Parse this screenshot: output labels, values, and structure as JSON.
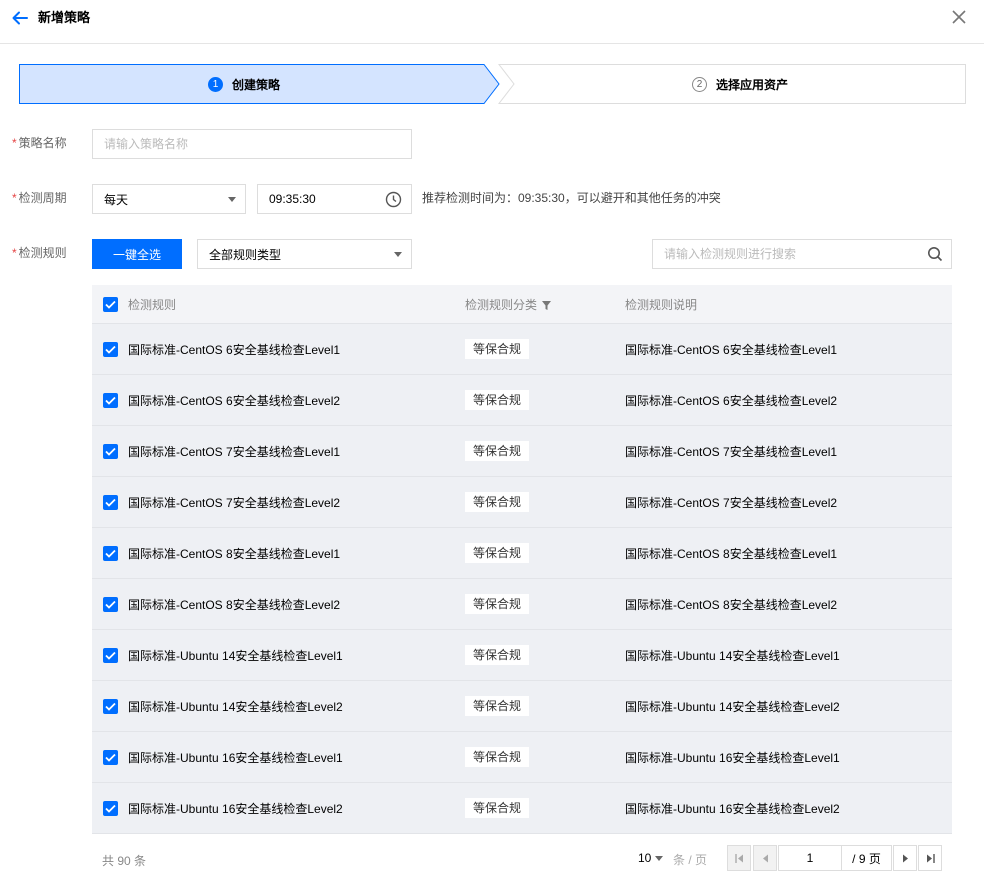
{
  "header": {
    "title": "新增策略"
  },
  "steps": [
    {
      "num": "1",
      "label": "创建策略"
    },
    {
      "num": "2",
      "label": "选择应用资产"
    }
  ],
  "form": {
    "name": {
      "label": "策略名称",
      "placeholder": "请输入策略名称",
      "value": ""
    },
    "period": {
      "label": "检测周期",
      "frequency": "每天",
      "time": "09:35:30",
      "hint": "推荐检测时间为：09:35:30，可以避开和其他任务的冲突"
    },
    "rules": {
      "label": "检测规则",
      "select_all": "一键全选",
      "type_filter": "全部规则类型",
      "search_placeholder": "请输入检测规则进行搜索"
    }
  },
  "table": {
    "headers": {
      "rule": "检测规则",
      "category": "检测规则分类",
      "description": "检测规则说明"
    },
    "rows": [
      {
        "rule": "国际标准-CentOS 6安全基线检查Level1",
        "category": "等保合规",
        "description": "国际标准-CentOS 6安全基线检查Level1"
      },
      {
        "rule": "国际标准-CentOS 6安全基线检查Level2",
        "category": "等保合规",
        "description": "国际标准-CentOS 6安全基线检查Level2"
      },
      {
        "rule": "国际标准-CentOS 7安全基线检查Level1",
        "category": "等保合规",
        "description": "国际标准-CentOS 7安全基线检查Level1"
      },
      {
        "rule": "国际标准-CentOS 7安全基线检查Level2",
        "category": "等保合规",
        "description": "国际标准-CentOS 7安全基线检查Level2"
      },
      {
        "rule": "国际标准-CentOS 8安全基线检查Level1",
        "category": "等保合规",
        "description": "国际标准-CentOS 8安全基线检查Level1"
      },
      {
        "rule": "国际标准-CentOS 8安全基线检查Level2",
        "category": "等保合规",
        "description": "国际标准-CentOS 8安全基线检查Level2"
      },
      {
        "rule": "国际标准-Ubuntu 14安全基线检查Level1",
        "category": "等保合规",
        "description": "国际标准-Ubuntu 14安全基线检查Level1"
      },
      {
        "rule": "国际标准-Ubuntu 14安全基线检查Level2",
        "category": "等保合规",
        "description": "国际标准-Ubuntu 14安全基线检查Level2"
      },
      {
        "rule": "国际标准-Ubuntu 16安全基线检查Level1",
        "category": "等保合规",
        "description": "国际标准-Ubuntu 16安全基线检查Level1"
      },
      {
        "rule": "国际标准-Ubuntu 16安全基线检查Level2",
        "category": "等保合规",
        "description": "国际标准-Ubuntu 16安全基线检查Level2"
      }
    ]
  },
  "pagination": {
    "total": "共 90 条",
    "page_size": "10",
    "per_page": "条 / 页",
    "current": "1",
    "page_total": "/ 9 页"
  },
  "colors": {
    "primary": "#006eff",
    "step_active_bg": "#d4e4ff",
    "required": "#e54545"
  }
}
